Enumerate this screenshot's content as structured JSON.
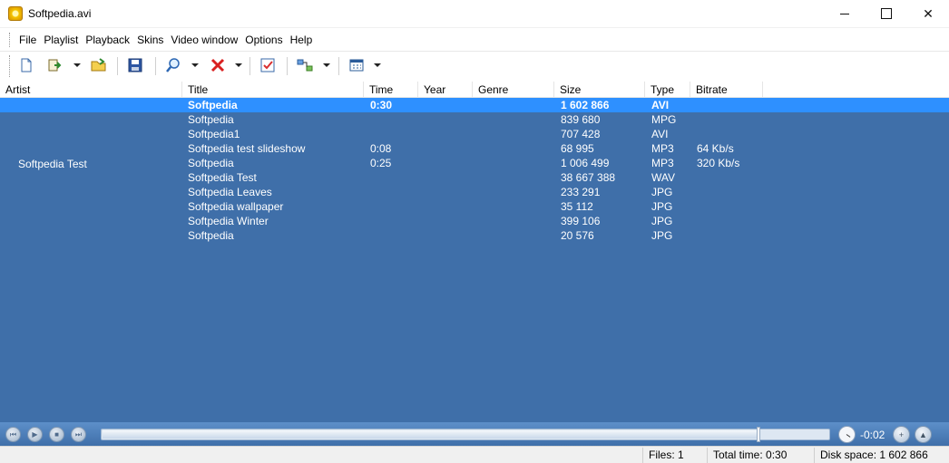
{
  "window": {
    "title": "Softpedia.avi",
    "icon": "app-icon",
    "controls": [
      "minimize",
      "maximize",
      "close"
    ],
    "close_glyph": "✕"
  },
  "menu": [
    "File",
    "Playlist",
    "Playback",
    "Skins",
    "Video window",
    "Options",
    "Help"
  ],
  "toolbar": {
    "icons": [
      "new-playlist-icon",
      "add-files-icon",
      "open-folder-icon",
      "save-icon",
      "search-icon",
      "delete-icon",
      "properties-icon",
      "arrange-icon",
      "view-icon"
    ]
  },
  "columns": [
    "Artist",
    "Title",
    "Time",
    "Year",
    "Genre",
    "Size",
    "Type",
    "Bitrate"
  ],
  "artist_group": "Softpedia Test",
  "rows": [
    {
      "title": "Softpedia",
      "time": "0:30",
      "size": "1 602 866",
      "type": "AVI",
      "bitrate": "",
      "selected": true
    },
    {
      "title": "Softpedia",
      "time": "",
      "size": "839 680",
      "type": "MPG",
      "bitrate": ""
    },
    {
      "title": "Softpedia1",
      "time": "",
      "size": "707 428",
      "type": "AVI",
      "bitrate": ""
    },
    {
      "title": "Softpedia test slideshow",
      "time": "0:08",
      "size": "68 995",
      "type": "MP3",
      "bitrate": "64 Kb/s"
    },
    {
      "title": "Softpedia",
      "time": "0:25",
      "size": "1 006 499",
      "type": "MP3",
      "bitrate": "320 Kb/s"
    },
    {
      "title": "Softpedia Test",
      "time": "",
      "size": "38 667 388",
      "type": "WAV",
      "bitrate": ""
    },
    {
      "title": "Softpedia Leaves",
      "time": "",
      "size": "233 291",
      "type": "JPG",
      "bitrate": ""
    },
    {
      "title": "Softpedia wallpaper",
      "time": "",
      "size": "35 112",
      "type": "JPG",
      "bitrate": ""
    },
    {
      "title": "Softpedia Winter",
      "time": "",
      "size": "399 106",
      "type": "JPG",
      "bitrate": ""
    },
    {
      "title": "Softpedia",
      "time": "",
      "size": "20 576",
      "type": "JPG",
      "bitrate": ""
    }
  ],
  "player": {
    "time_remaining": "-0:02",
    "seek_position": 0.9,
    "buttons": [
      "previous",
      "play",
      "stop",
      "next"
    ],
    "button_glyphs": [
      "⏮",
      "▶",
      "■",
      "⏭"
    ],
    "volume_glyphs": [
      "+",
      "▲"
    ]
  },
  "status": {
    "files": "Files: 1",
    "total_time": "Total time: 0:30",
    "disk_space": "Disk space: 1 602 866"
  },
  "colors": {
    "list_background": "#3f6fa9",
    "selected_row": "#2e90ff",
    "list_text": "#ffffff"
  }
}
